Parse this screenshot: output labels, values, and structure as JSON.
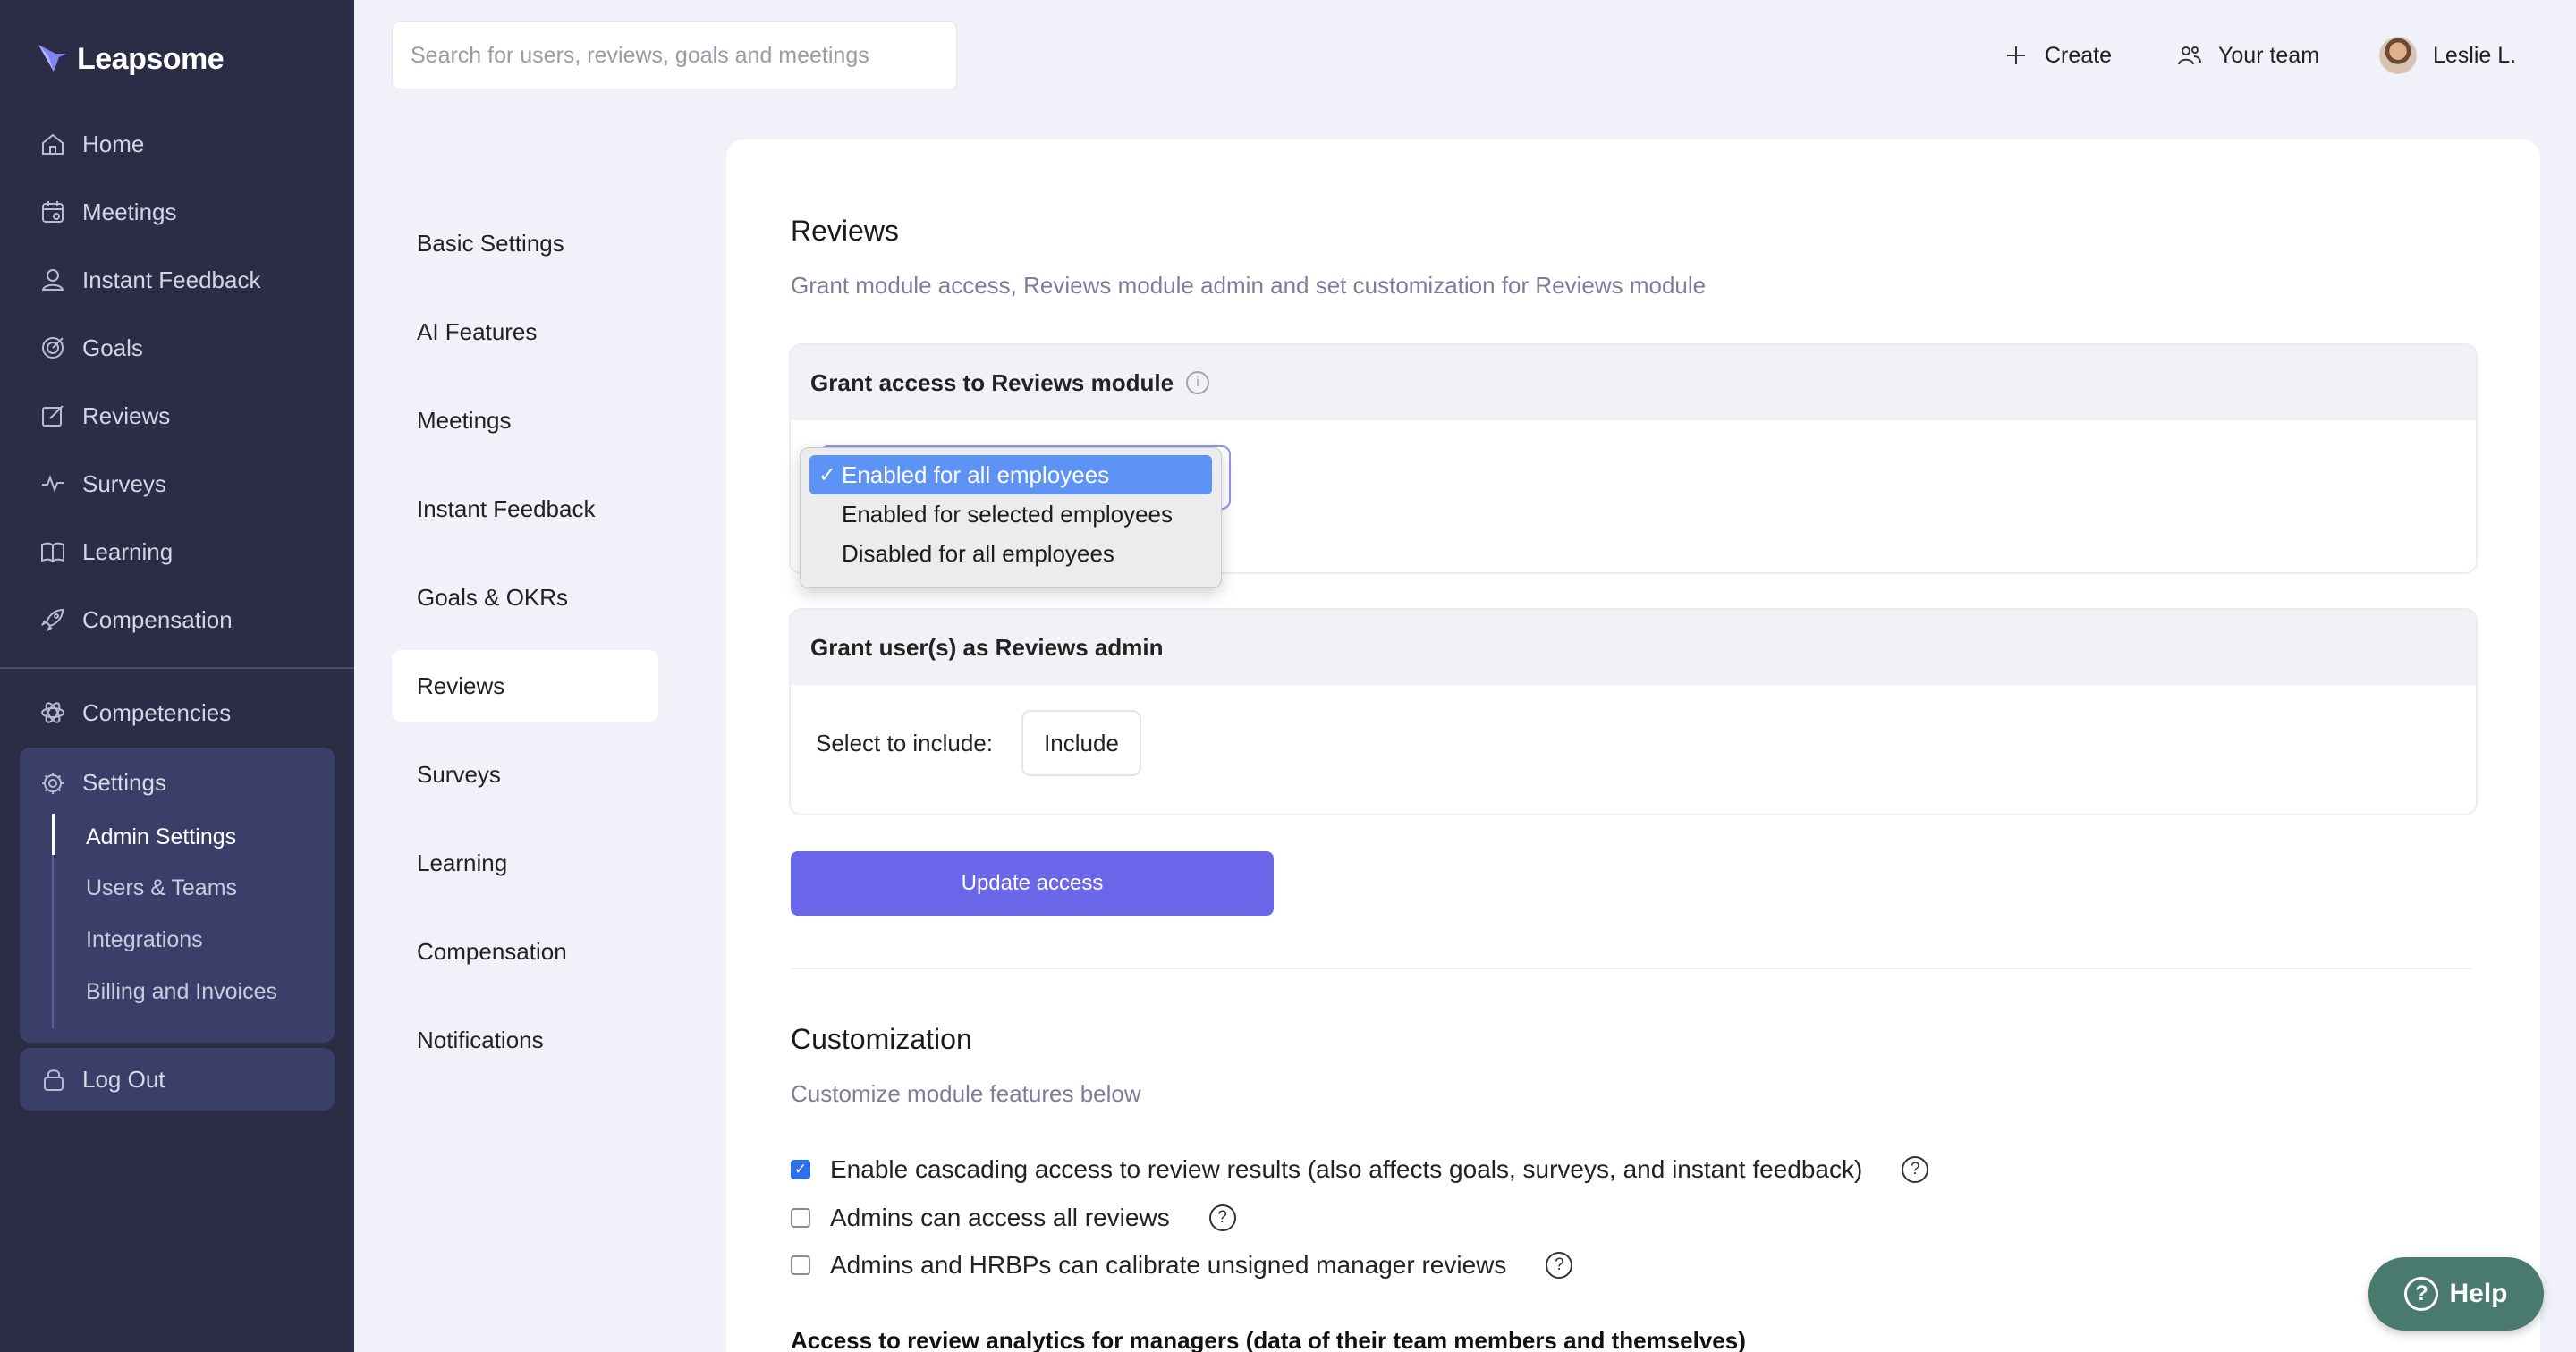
{
  "brand": {
    "name": "Leapsome",
    "accent": "#6966ea",
    "sidebar_bg": "#2a2d45"
  },
  "sidebar": {
    "items": [
      {
        "label": "Home",
        "icon": "home-icon"
      },
      {
        "label": "Meetings",
        "icon": "calendar-icon"
      },
      {
        "label": "Instant Feedback",
        "icon": "feedback-icon"
      },
      {
        "label": "Goals",
        "icon": "target-icon"
      },
      {
        "label": "Reviews",
        "icon": "edit-icon"
      },
      {
        "label": "Surveys",
        "icon": "pulse-icon"
      },
      {
        "label": "Learning",
        "icon": "book-icon"
      },
      {
        "label": "Compensation",
        "icon": "rocket-icon"
      },
      {
        "label": "Competencies",
        "icon": "atom-icon"
      }
    ],
    "settings": {
      "label": "Settings",
      "sub": [
        {
          "label": "Admin Settings"
        },
        {
          "label": "Users & Teams"
        },
        {
          "label": "Integrations"
        },
        {
          "label": "Billing and Invoices"
        }
      ]
    },
    "logout": "Log Out"
  },
  "topbar": {
    "search_placeholder": "Search for users, reviews, goals and meetings",
    "create": "Create",
    "team": "Your team",
    "user": "Leslie L."
  },
  "submenu": [
    "Basic Settings",
    "AI Features",
    "Meetings",
    "Instant Feedback",
    "Goals & OKRs",
    "Reviews",
    "Surveys",
    "Learning",
    "Compensation",
    "Notifications"
  ],
  "reviews": {
    "title": "Reviews",
    "subtitle": "Grant module access, Reviews module admin and set customization for Reviews module",
    "grant_access_title": "Grant access to Reviews module",
    "access_options": [
      "Enabled for all employees",
      "Enabled for selected employees",
      "Disabled for all employees"
    ],
    "selected_option": "Enabled for all employees",
    "admin_title": "Grant user(s) as Reviews admin",
    "select_label": "Select to include:",
    "include_button": "Include",
    "update_button": "Update access"
  },
  "customization": {
    "title": "Customization",
    "subtitle": "Customize module features below",
    "options": [
      {
        "label": "Enable cascading access to review results (also affects goals, surveys, and instant feedback)",
        "checked": true
      },
      {
        "label": "Admins can access all reviews",
        "checked": false
      },
      {
        "label": "Admins and HRBPs can calibrate unsigned manager reviews",
        "checked": false
      }
    ],
    "analytics_title": "Access to review analytics for managers (data of their team members and themselves)"
  },
  "help": "Help"
}
